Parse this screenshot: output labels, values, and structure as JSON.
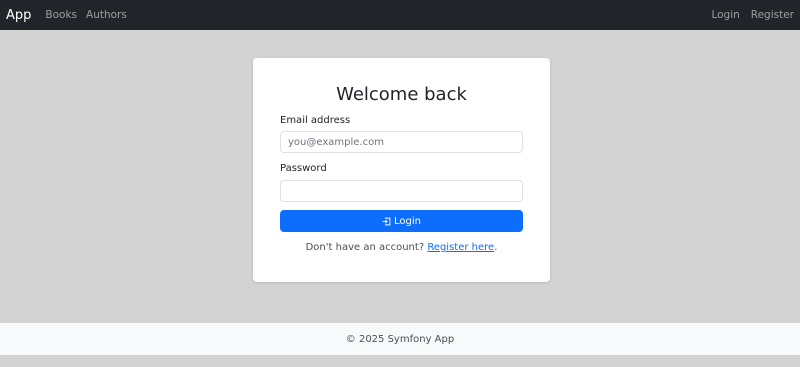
{
  "navbar": {
    "brand": "App",
    "left_links": [
      "Books",
      "Authors"
    ],
    "right_links": [
      "Login",
      "Register"
    ]
  },
  "login_card": {
    "title": "Welcome back",
    "email_label": "Email address",
    "email_placeholder": "you@example.com",
    "email_value": "",
    "password_label": "Password",
    "password_value": "",
    "submit_label": "Login",
    "submit_icon": "box-arrow-in-right-icon",
    "register_prompt": "Don't have an account?",
    "register_link": "Register here",
    "register_suffix": "."
  },
  "footer": {
    "text": "© 2025 Symfony App"
  },
  "colors": {
    "navbar_bg": "#212529",
    "page_bg": "#d3d3d3",
    "primary": "#0d6efd",
    "footer_bg": "#f8f9fa"
  }
}
